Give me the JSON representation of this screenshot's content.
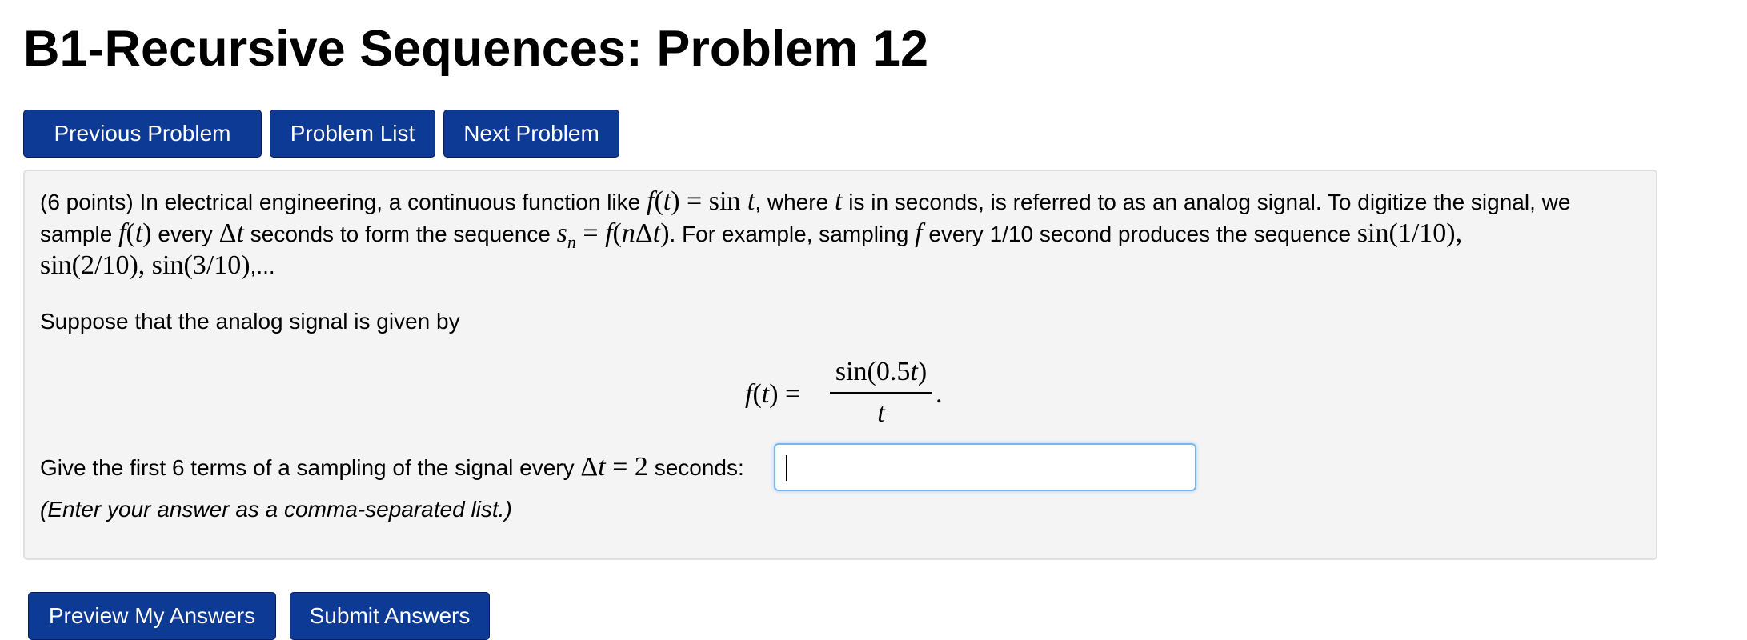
{
  "page_title": "B1-Recursive Sequences: Problem 12",
  "nav": {
    "previous": "Previous Problem",
    "list": "Problem List",
    "next": "Next Problem"
  },
  "problem": {
    "line1_intro": "(6 points) In electrical engineering, a continuous function like ",
    "line1_mid1": ", where ",
    "line1_mid2": " is in seconds, is referred to as an analog signal. To digitize the signal, we",
    "line2_a": "sample ",
    "line2_b": " every ",
    "line2_c": " seconds to form the sequence ",
    "line2_d": ". For example, sampling ",
    "line2_e": " every 1/10 second produces the sequence ",
    "line3_tail": ",...",
    "suppose_text": "Suppose that the analog signal is given by",
    "give_text": "Give the first 6 terms of a sampling of the signal every ",
    "give_tail": " seconds:",
    "answer_value": "",
    "hint": "(Enter your answer as a comma-separated list.)"
  },
  "actions": {
    "preview": "Preview My Answers",
    "submit": "Submit Answers"
  },
  "colors": {
    "button_bg": "#0d3a95",
    "box_bg": "#f4f4f4",
    "input_focus": "#77b6f0"
  }
}
